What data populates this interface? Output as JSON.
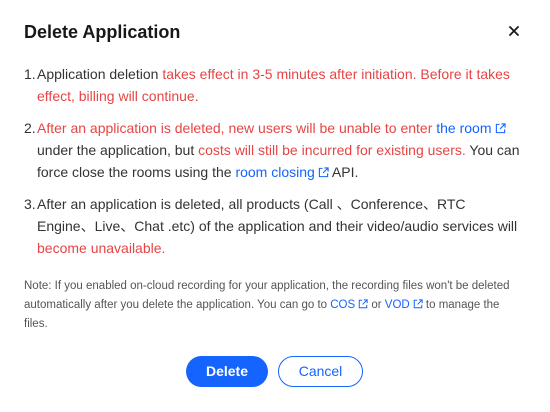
{
  "dialog": {
    "title": "Delete Application",
    "close_icon": "close-icon"
  },
  "steps": [
    {
      "num": "1.",
      "parts": [
        {
          "text": "Application deletion ",
          "style": "normal"
        },
        {
          "text": "takes effect in 3-5 minutes after initiation. Before it takes effect, billing will continue.",
          "style": "red"
        }
      ]
    },
    {
      "num": "2.",
      "parts": [
        {
          "text": "After an application is deleted, new users will be unable to enter ",
          "style": "red"
        },
        {
          "text": "the room",
          "style": "link"
        },
        {
          "text": " under the application, but ",
          "style": "normal"
        },
        {
          "text": "costs will still be incurred for existing users.",
          "style": "red"
        },
        {
          "text": " You can force close the rooms using the ",
          "style": "normal"
        },
        {
          "text": "room closing",
          "style": "link"
        },
        {
          "text": " API.",
          "style": "normal"
        }
      ]
    },
    {
      "num": "3.",
      "parts": [
        {
          "text": "After an application is deleted, all products (Call 、Conference、RTC Engine、Live、Chat .etc) of the application and their video/audio services will ",
          "style": "normal"
        },
        {
          "text": "become unavailable.",
          "style": "red"
        }
      ]
    }
  ],
  "note": {
    "parts": [
      {
        "text": "Note: If you enabled on-cloud recording for your application, the recording files won't be deleted automatically after you delete the application. You can go to ",
        "style": "normal"
      },
      {
        "text": "COS",
        "style": "link"
      },
      {
        "text": " or ",
        "style": "normal"
      },
      {
        "text": "VOD",
        "style": "link"
      },
      {
        "text": " to manage the files.",
        "style": "normal"
      }
    ]
  },
  "buttons": {
    "delete_label": "Delete",
    "cancel_label": "Cancel"
  },
  "colors": {
    "accent": "#1664ff",
    "warning_text": "#e54545",
    "title": "#16181a"
  },
  "icons": {
    "external_link": "external-link-icon"
  }
}
